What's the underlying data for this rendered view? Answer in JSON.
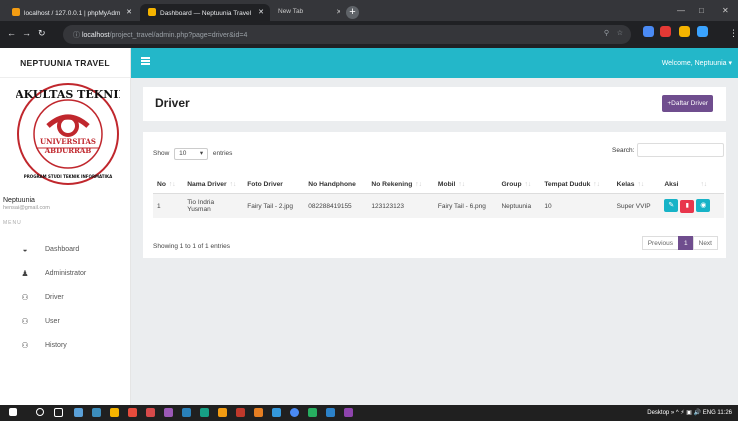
{
  "browser": {
    "tabs": [
      {
        "label": "localhost / 127.0.0.1 | phpMyAdm"
      },
      {
        "label": "Dashboard — Neptuunia Travel"
      },
      {
        "label": "New Tab"
      }
    ],
    "url_host": "localhost",
    "url_path": "/project_travel/admin.php?page=driver&id=4",
    "ext_colors": [
      "#4a8af4",
      "#e53935",
      "#f5b400",
      "#3aa3ff"
    ]
  },
  "sidebar": {
    "brand": "NEPTUUNIA TRAVEL",
    "logo": {
      "arc_top": "FAKULTAS TEKNIK",
      "inner1": "UNIVERSITAS",
      "inner2": "ABDURRAB",
      "arc_bottom": "PROGRAM STUDI TEKNIK INFORMATIKA"
    },
    "user_name": "Neptuunia",
    "user_email": "hensai@gmail.com",
    "menu_heading": "MENU",
    "items": [
      {
        "label": "Dashboard",
        "icon": "dashboard-icon",
        "glyph": "◒"
      },
      {
        "label": "Administrator",
        "icon": "user-icon",
        "glyph": "♟"
      },
      {
        "label": "Driver",
        "icon": "users-icon",
        "glyph": "⚇"
      },
      {
        "label": "User",
        "icon": "users-icon",
        "glyph": "⚇"
      },
      {
        "label": "History",
        "icon": "users-icon",
        "glyph": "⚇"
      }
    ]
  },
  "topbar": {
    "welcome": "Welcome, Neptuunia ▾",
    "color": "#23b7c9"
  },
  "page": {
    "title": "Driver",
    "add_button": "+Daftar Driver",
    "accent": "#6f4d8e"
  },
  "table": {
    "show_label": "Show",
    "entries_value": "10",
    "entries_label": "entries",
    "search_label": "Search:",
    "columns": [
      "No",
      "Nama Driver",
      "Foto Driver",
      "No Handphone",
      "No Rekening",
      "Mobil",
      "Group",
      "Tempat Duduk",
      "Kelas",
      "Aksi"
    ],
    "rows": [
      [
        "1",
        "Tio Indria Yusman",
        "Fairy Tail - 2.jpg",
        "082288419155",
        "123123123",
        "Fairy Tail - 6.png",
        "Neptuunia",
        "10",
        "Super VVIP"
      ]
    ],
    "actions": [
      {
        "icon": "edit-icon",
        "glyph": "✎",
        "color": "#17b3c7"
      },
      {
        "icon": "delete-icon",
        "glyph": "🗑",
        "color": "#e8364c"
      },
      {
        "icon": "view-icon",
        "glyph": "👁",
        "color": "#17b3c7"
      }
    ],
    "info": "Showing 1 to 1 of 1 entries",
    "pager": {
      "prev": "Previous",
      "page": "1",
      "next": "Next"
    }
  },
  "taskbar": {
    "tray": "Desktop »  ^  ⚡ ▣ 🔊 ENG  11:26"
  }
}
